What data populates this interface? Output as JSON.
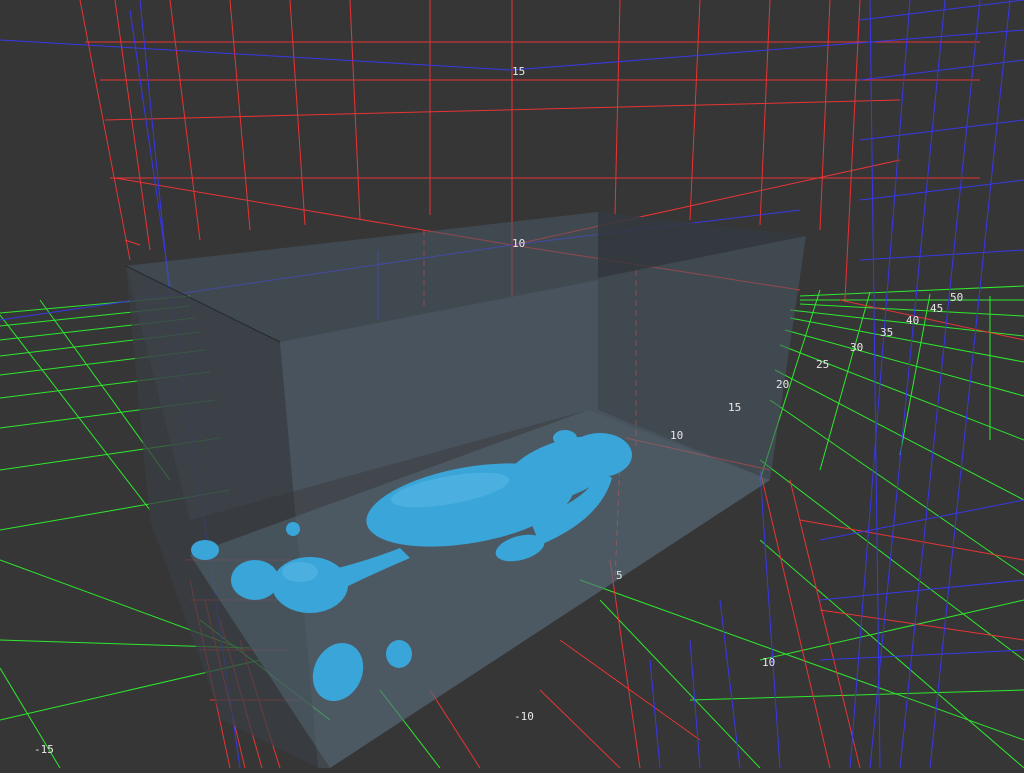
{
  "scene": {
    "background_color": "#363636",
    "grid_colors": {
      "x_axis": "#e83434",
      "y_axis": "#3838e8",
      "z_axis": "#2ee82e"
    },
    "volume_box_color": "#4a5a66",
    "fluid_color": "#3aa5d8"
  },
  "axis_labels": {
    "red_15": "15",
    "red_10": "10",
    "red_5": "5",
    "green_10": "10",
    "green_15": "15",
    "green_20": "20",
    "green_25": "25",
    "green_30": "30",
    "green_35": "35",
    "green_40": "40",
    "green_45": "45",
    "green_50": "50",
    "floor_10": "10",
    "floor_neg10": "-10",
    "floor_neg15": "-15"
  }
}
